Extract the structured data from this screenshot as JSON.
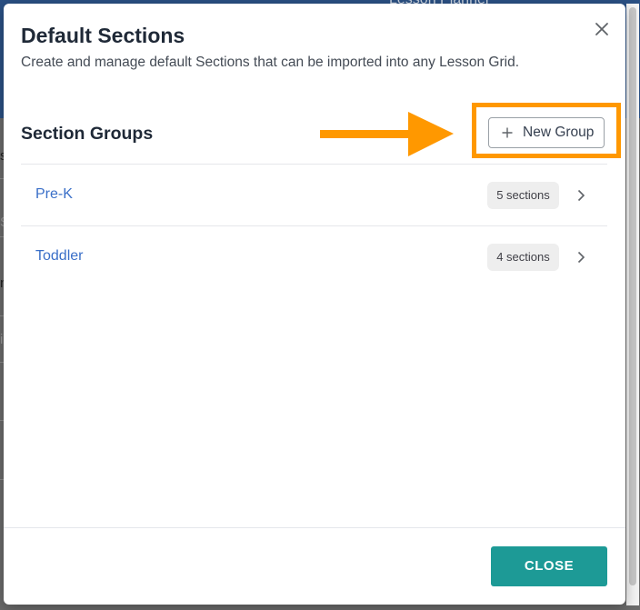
{
  "background": {
    "window_title": "Lesson Planner",
    "glyphs": [
      "s",
      "S",
      "n",
      "i"
    ]
  },
  "dialog": {
    "title": "Default Sections",
    "subtitle": "Create and manage default Sections that can be imported into any Lesson Grid.",
    "close_icon": "close-icon"
  },
  "section_groups": {
    "heading": "Section Groups",
    "new_group_label": "New Group",
    "new_group_icon": "plus-icon",
    "groups": [
      {
        "label": "Pre-K",
        "badge": "5 sections"
      },
      {
        "label": "Toddler",
        "badge": "4 sections"
      }
    ]
  },
  "annotation": {
    "arrow_icon": "arrow-right-icon",
    "color": "#ff9800"
  },
  "footer": {
    "close_label": "CLOSE"
  },
  "colors": {
    "accent": "#1d9a96",
    "link": "#3a6fc8",
    "header_bg": "#2a5084"
  }
}
